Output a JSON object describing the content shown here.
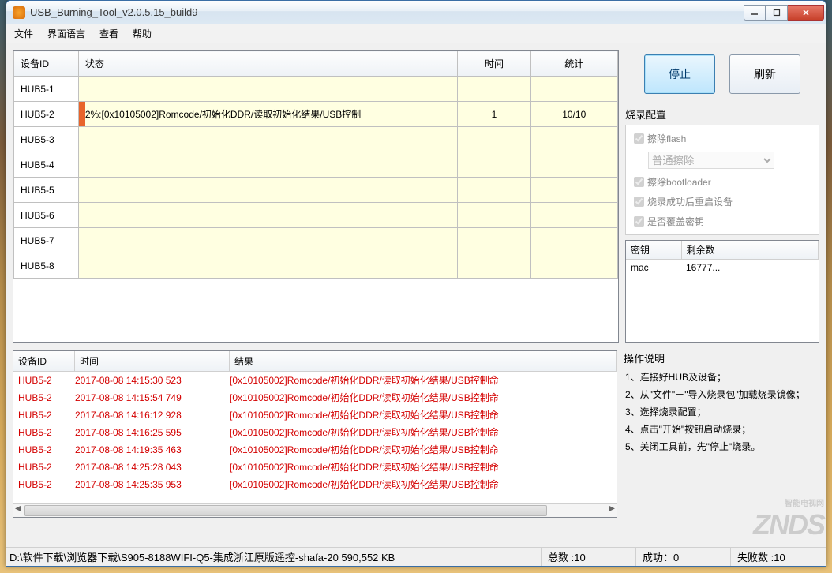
{
  "window": {
    "title": "USB_Burning_Tool_v2.0.5.15_build9"
  },
  "menu": {
    "file": "文件",
    "lang": "界面语言",
    "view": "查看",
    "help": "帮助"
  },
  "dev_table": {
    "headers": {
      "id": "设备ID",
      "status": "状态",
      "time": "时间",
      "count": "统计"
    },
    "rows": [
      {
        "id": "HUB5-1",
        "status": "",
        "time": "",
        "count": ""
      },
      {
        "id": "HUB5-2",
        "status": "2%:[0x10105002]Romcode/初始化DDR/读取初始化结果/USB控制",
        "time": "1",
        "count": "10/10",
        "active": true
      },
      {
        "id": "HUB5-3",
        "status": "",
        "time": "",
        "count": ""
      },
      {
        "id": "HUB5-4",
        "status": "",
        "time": "",
        "count": ""
      },
      {
        "id": "HUB5-5",
        "status": "",
        "time": "",
        "count": ""
      },
      {
        "id": "HUB5-6",
        "status": "",
        "time": "",
        "count": ""
      },
      {
        "id": "HUB5-7",
        "status": "",
        "time": "",
        "count": ""
      },
      {
        "id": "HUB5-8",
        "status": "",
        "time": "",
        "count": ""
      }
    ]
  },
  "buttons": {
    "stop": "停止",
    "refresh": "刷新"
  },
  "config": {
    "title": "烧录配置",
    "erase_flash": "擦除flash",
    "erase_mode": "普通擦除",
    "erase_bootloader": "擦除bootloader",
    "reboot_after": "烧录成功后重启设备",
    "overwrite_key": "是否覆盖密钥"
  },
  "key_table": {
    "headers": {
      "key": "密钥",
      "remain": "剩余数"
    },
    "rows": [
      {
        "key": "mac",
        "remain": "16777..."
      }
    ]
  },
  "log_table": {
    "headers": {
      "id": "设备ID",
      "time": "时间",
      "result": "结果"
    },
    "rows": [
      {
        "id": "HUB5-2",
        "time": "2017-08-08 14:15:30 523",
        "result": "[0x10105002]Romcode/初始化DDR/读取初始化结果/USB控制命"
      },
      {
        "id": "HUB5-2",
        "time": "2017-08-08 14:15:54 749",
        "result": "[0x10105002]Romcode/初始化DDR/读取初始化结果/USB控制命"
      },
      {
        "id": "HUB5-2",
        "time": "2017-08-08 14:16:12 928",
        "result": "[0x10105002]Romcode/初始化DDR/读取初始化结果/USB控制命"
      },
      {
        "id": "HUB5-2",
        "time": "2017-08-08 14:16:25 595",
        "result": "[0x10105002]Romcode/初始化DDR/读取初始化结果/USB控制命"
      },
      {
        "id": "HUB5-2",
        "time": "2017-08-08 14:19:35 463",
        "result": "[0x10105002]Romcode/初始化DDR/读取初始化结果/USB控制命"
      },
      {
        "id": "HUB5-2",
        "time": "2017-08-08 14:25:28 043",
        "result": "[0x10105002]Romcode/初始化DDR/读取初始化结果/USB控制命"
      },
      {
        "id": "HUB5-2",
        "time": "2017-08-08 14:25:35 953",
        "result": "[0x10105002]Romcode/初始化DDR/读取初始化结果/USB控制命"
      }
    ]
  },
  "instructions": {
    "title": "操作说明",
    "items": [
      "1、连接好HUB及设备；",
      "2、从\"文件\"－\"导入烧录包\"加载烧录镜像；",
      "3、选择烧录配置；",
      "4、点击\"开始\"按钮启动烧录；",
      "5、关闭工具前，先\"停止\"烧录。"
    ]
  },
  "statusbar": {
    "path": "D:\\软件下载\\浏览器下载\\S905-8188WIFI-Q5-集成浙江原版遥控-shafa-20 590,552 KB",
    "total": "总数 :10",
    "success": "成功：0",
    "fail": "失败数 :10"
  },
  "watermark": {
    "big": "ZNDS",
    "small": "智能电视网"
  }
}
